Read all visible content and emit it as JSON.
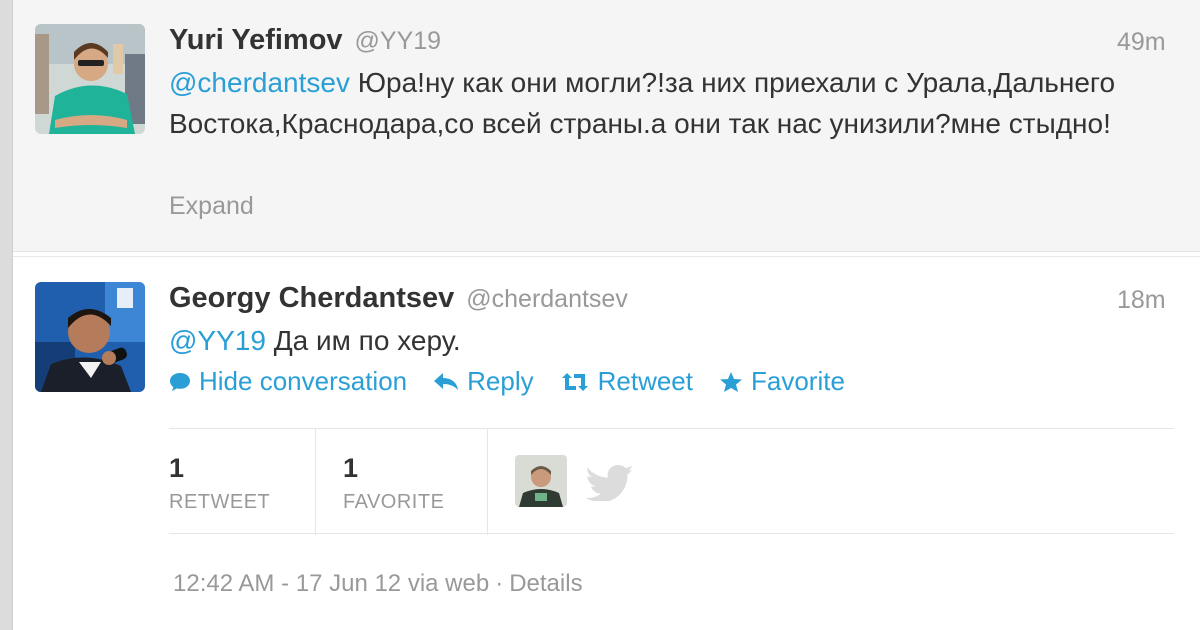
{
  "tweet1": {
    "name": "Yuri Yefimov",
    "handle": "@YY19",
    "time": "49m",
    "mention": "@cherdantsev",
    "text": " Юра!ну как они могли?!за них приехали с Урала,Дальнего Востока,Краснодара,со всей страны.а они так нас унизили?мне стыдно!",
    "expand": "Expand"
  },
  "tweet2": {
    "name": "Georgy Cherdantsev",
    "handle": "@cherdantsev",
    "time": "18m",
    "mention": "@YY19",
    "text": " Да им по херу.",
    "actions": {
      "hide": "Hide conversation",
      "reply": "Reply",
      "retweet": "Retweet",
      "favorite": "Favorite"
    },
    "stats": {
      "retweets_num": "1",
      "retweets_label": "RETWEET",
      "favorites_num": "1",
      "favorites_label": "FAVORITE"
    },
    "footer": {
      "time": "12:42 AM - 17 Jun 12 via web",
      "sep": "·",
      "details": "Details"
    }
  },
  "colors": {
    "link": "#2a9fd6",
    "muted": "#999999",
    "text": "#333333"
  }
}
